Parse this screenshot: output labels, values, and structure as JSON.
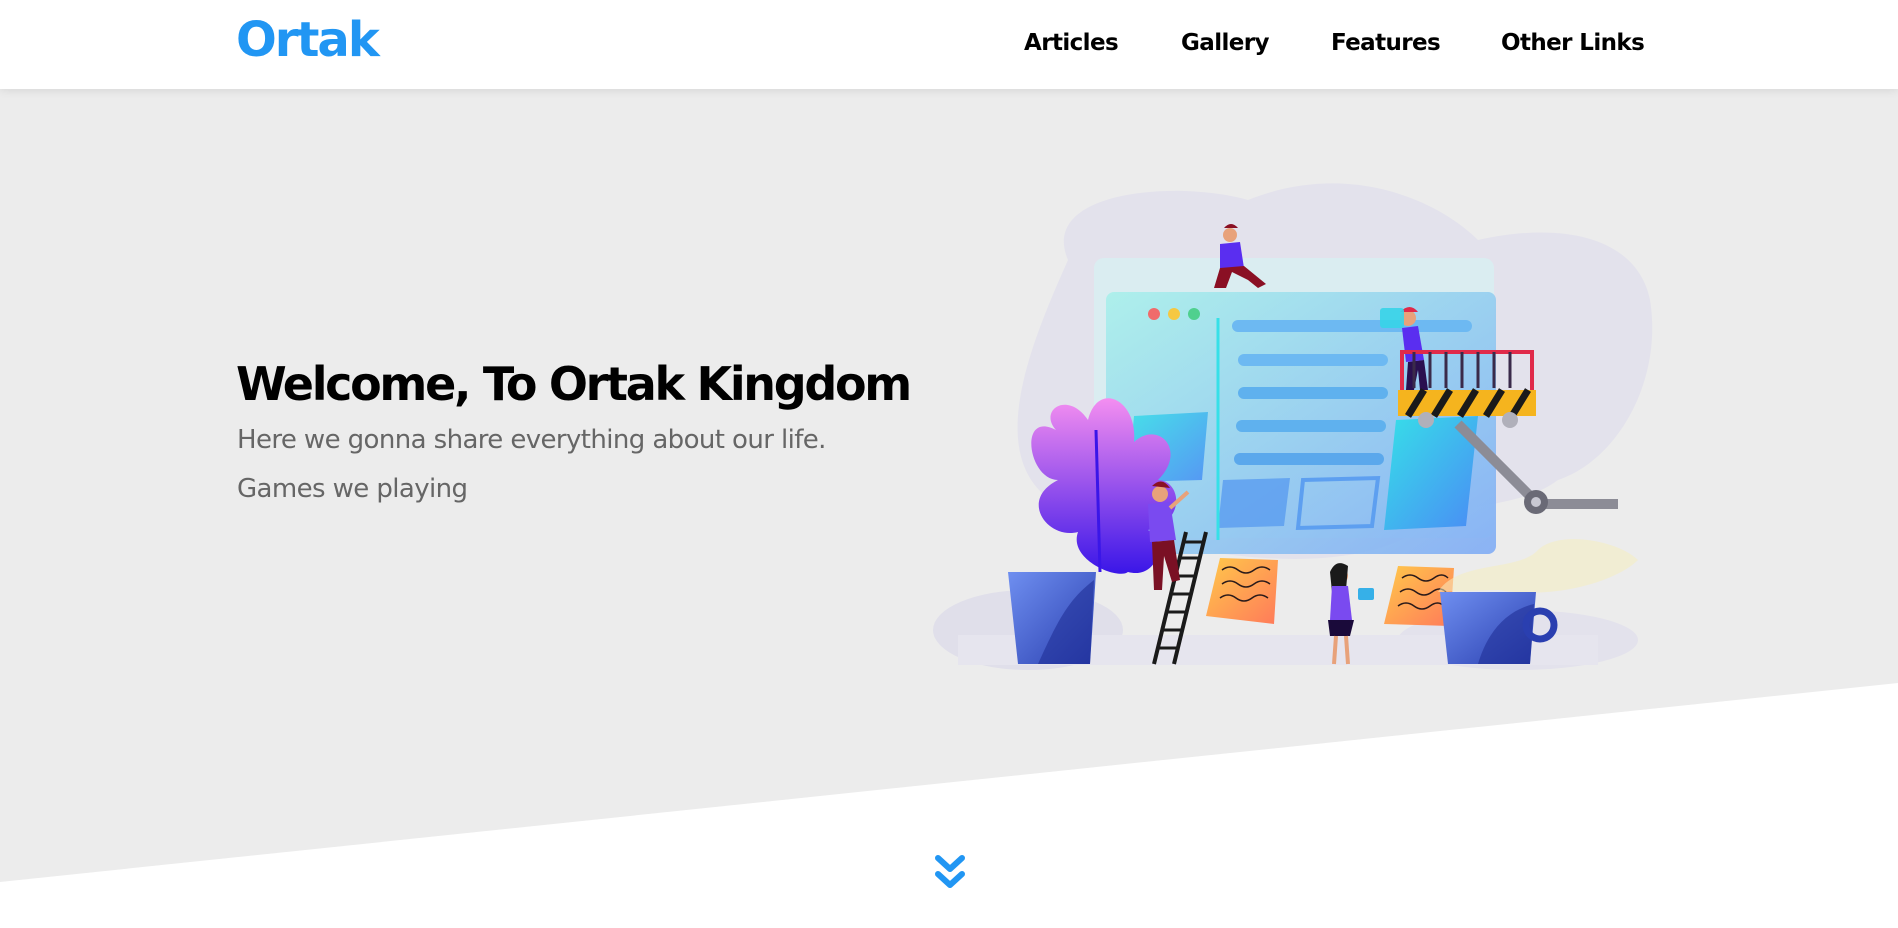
{
  "header": {
    "logo": "Ortak",
    "nav": [
      {
        "label": "Articles"
      },
      {
        "label": "Gallery"
      },
      {
        "label": "Features"
      },
      {
        "label": "Other Links"
      }
    ]
  },
  "hero": {
    "title": "Welcome, To Ortak Kingdom",
    "lines": [
      "Here we gonna share everything about our life.",
      "Games we playing"
    ],
    "illustration": "website-building-illustration"
  },
  "scroll_down_icon": "double-chevron-down-icon",
  "colors": {
    "brand": "#2196f3",
    "hero_background": "#ececec",
    "subtitle_text": "#666666",
    "nav_text": "#000000"
  }
}
